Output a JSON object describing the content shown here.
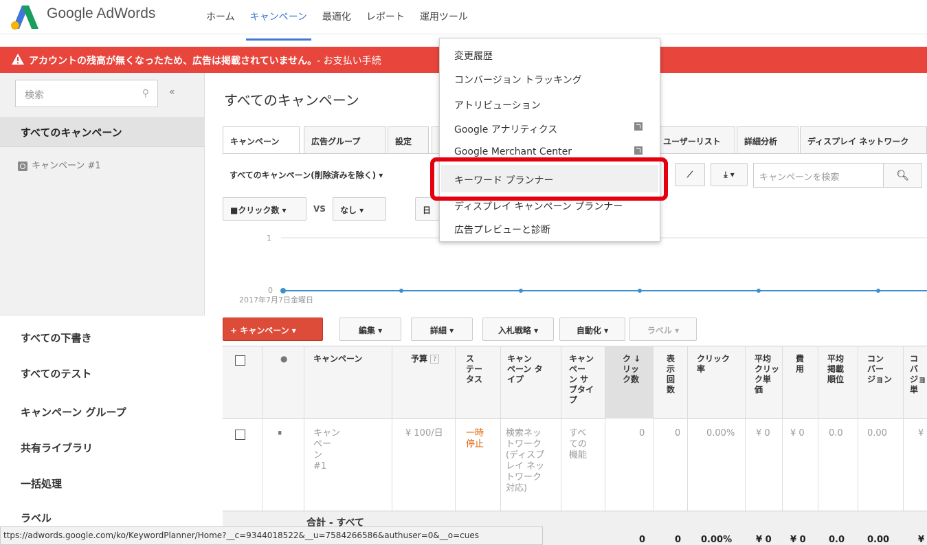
{
  "app": {
    "logo_text": "Google AdWords"
  },
  "nav": [
    "ホーム",
    "キャンペーン",
    "最適化",
    "レポート",
    "運用ツール"
  ],
  "alert": {
    "text": "アカウントの残高が無くなったため、広告は掲載されていません。",
    "sub": "- お支払い手続"
  },
  "sidebar": {
    "search_placeholder": "検索",
    "selected": "すべてのキャンペーン",
    "campaign": "キャンペーン #1",
    "links": [
      "すべての下書き",
      "すべてのテスト",
      "キャンペーン グループ",
      "共有ライブラリ",
      "一括処理",
      "ラベル"
    ]
  },
  "main": {
    "title": "すべてのキャンペーン",
    "tabs": [
      "キャンペーン",
      "広告グループ",
      "設定",
      "ユーザーリスト",
      "詳細分析",
      "ディスプレイ ネットワーク"
    ],
    "filter": "すべてのキャンペーン(削除済みを除く) ▾",
    "metric1": "■クリック数 ▾",
    "vs": "VS",
    "metric2": "なし ▾",
    "date_btn": "日",
    "search_campaign_placeholder": "キャンペーンを検索",
    "chart_tick": "1",
    "chart_zero": "0",
    "chart_date": "2017年7月7日金曜日",
    "toolbar": [
      "+ キャンペーン ▾",
      "編集 ▾",
      "詳細 ▾",
      "入札戦略 ▾",
      "自動化 ▾",
      "ラベル ▾"
    ]
  },
  "menu": {
    "items": [
      "変更履歴",
      "コンバージョン トラッキング",
      "アトリビューション",
      "Google アナリティクス",
      "Google Merchant Center",
      "キーワード プランナー",
      "ディスプレイ キャンペーン プランナー",
      "広告プレビューと診断"
    ]
  },
  "table": {
    "headers": [
      "キャンペーン",
      "予算",
      "ス\nテー\nタス",
      "キャン\nペーン タ\nイプ",
      "キャン\nペー\nン サ\nブタイ\nプ",
      "ク ↓\nリッ\nク数",
      "表\n示\n回\n数",
      "クリック\n率",
      "平均\nクリッ\nク単\n価",
      "費\n用",
      "平均\n掲載\n順位",
      "コン\nバー\nジョン",
      "コ\nバ\nジョ\n単"
    ],
    "row": {
      "campaign": "キャン\nペー\nン\n#1",
      "budget": "¥ 100/日",
      "status": "一時\n停止",
      "type": "検索ネッ\nトワーク\n(ディスプ\nレイ ネッ\nトワーク\n対応)",
      "subtype": "すべ\nての\n機能",
      "clicks": "0",
      "impr": "0",
      "ctr": "0.00%",
      "cpc": "¥ 0",
      "cost": "¥ 0",
      "pos": "0.0",
      "conv": "0.00",
      "cpa": "¥"
    },
    "total_label": "合計 - すべて",
    "total": [
      "0",
      "0",
      "0.00%",
      "¥ 0",
      "¥ 0",
      "0.0",
      "0.00",
      "¥"
    ]
  },
  "statusbar": "ttps://adwords.google.com/ko/KeywordPlanner/Home?__c=9344018522&__u=7584266586&authuser=0&__o=cues",
  "colors": {
    "accent": "#3f77d6",
    "alert": "#e8453c",
    "highlight": "#e4000f",
    "series": "#3a8fcf"
  }
}
